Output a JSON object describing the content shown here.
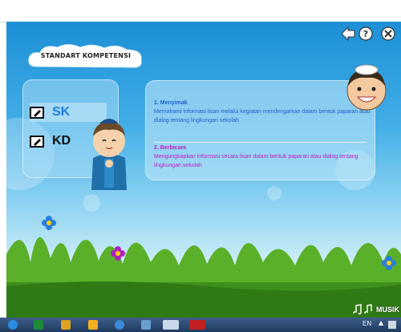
{
  "header": {
    "title": "STANDART KOMPETENSI"
  },
  "menu": {
    "items": [
      {
        "label": "SK",
        "color": "#1a7fe0",
        "active": true
      },
      {
        "label": "KD",
        "color": "#111111",
        "active": false
      }
    ]
  },
  "content": {
    "section1": {
      "title": "1. Menyimak",
      "text": "Memahami informasi lisan melalui kegiatan mendengarkan dalam bentuk paparan atau dialog tentang lingkungan sekolah",
      "color": "#1f5fc8"
    },
    "section2": {
      "title": "2. Berbicara",
      "text": "Mengungkapkan informasi secara lisan dalam bentuk paparan atau dialog tentang lingkungan sekolah",
      "color": "#c020c0"
    }
  },
  "footer": {
    "music_label": "MUSIK"
  },
  "taskbar": {
    "language": "EN"
  },
  "icons": [
    "back-icon",
    "help-icon",
    "close-icon",
    "music-notes-icon"
  ]
}
